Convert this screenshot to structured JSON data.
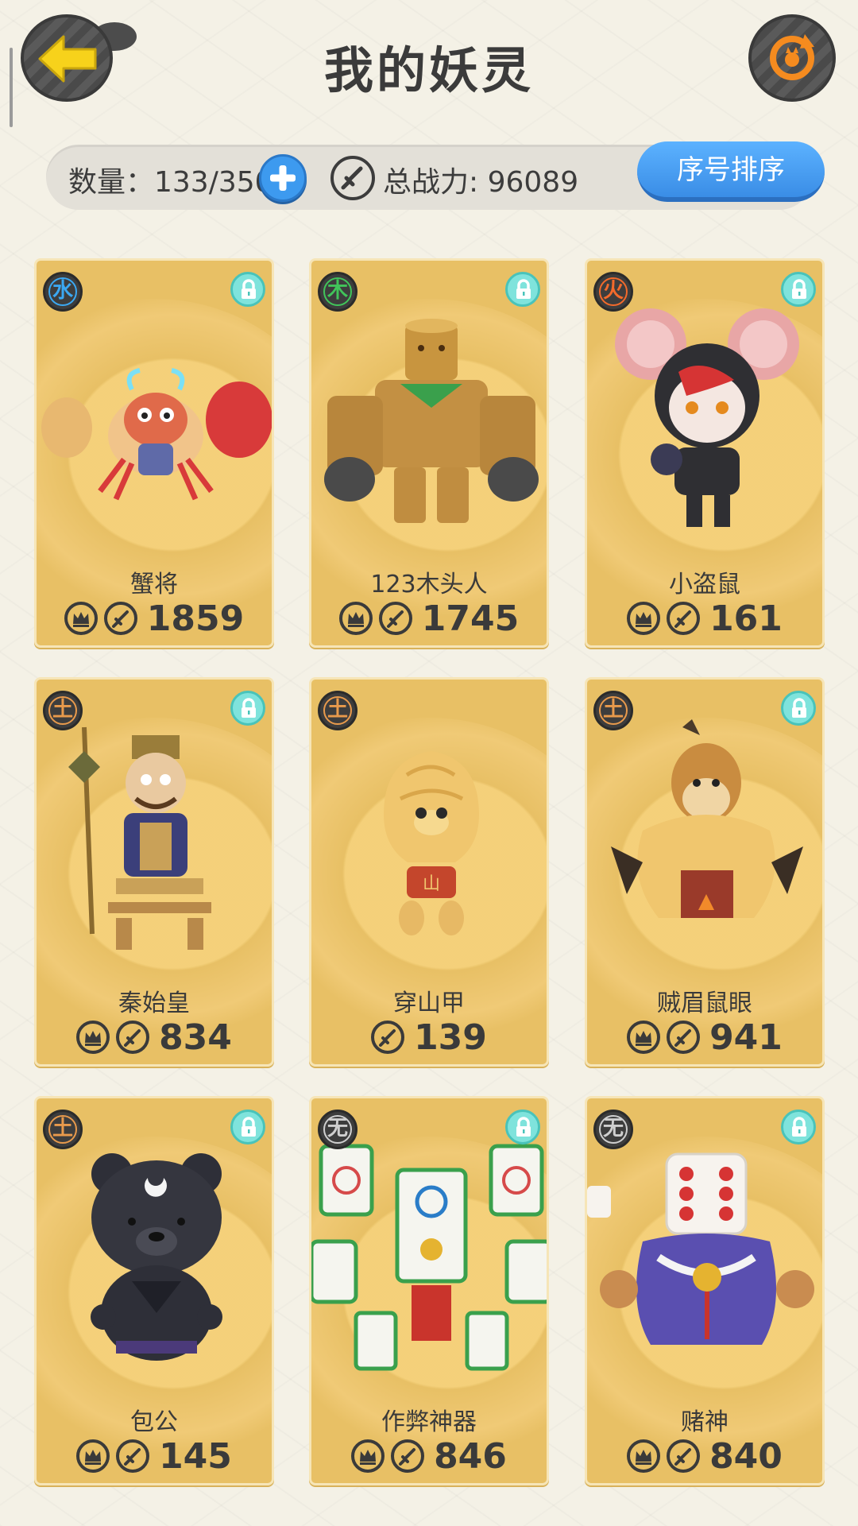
{
  "header": {
    "title": "我的妖灵"
  },
  "stats": {
    "count_text": "数量：133/350",
    "power_text": "总战力: 96089",
    "sort_label": "序号排序"
  },
  "colors": {
    "card": "#e8c065",
    "accent_blue": "#3d9aef",
    "back_arrow": "#f7d21b",
    "refresh_orange": "#f58b1f"
  },
  "cards": [
    {
      "name": "蟹将",
      "element": "水",
      "element_color": "#3ba8f2",
      "power": "1859",
      "crowned": true,
      "locked": true,
      "portrait": "crab"
    },
    {
      "name": "123木头人",
      "element": "木",
      "element_color": "#41c45a",
      "power": "1745",
      "crowned": true,
      "locked": true,
      "portrait": "wood"
    },
    {
      "name": "小盗鼠",
      "element": "火",
      "element_color": "#f36a2b",
      "power": "161",
      "crowned": true,
      "locked": true,
      "portrait": "mouse"
    },
    {
      "name": "秦始皇",
      "element": "土",
      "element_color": "#e89a4c",
      "power": "834",
      "crowned": true,
      "locked": true,
      "portrait": "emperor"
    },
    {
      "name": "穿山甲",
      "element": "土",
      "element_color": "#e89a4c",
      "power": "139",
      "crowned": false,
      "locked": false,
      "portrait": "pangolin"
    },
    {
      "name": "贼眉鼠眼",
      "element": "土",
      "element_color": "#e89a4c",
      "power": "941",
      "crowned": true,
      "locked": true,
      "portrait": "weasel"
    },
    {
      "name": "包公",
      "element": "土",
      "element_color": "#e89a4c",
      "power": "145",
      "crowned": true,
      "locked": true,
      "portrait": "bear"
    },
    {
      "name": "作弊神器",
      "element": "无",
      "element_color": "#cfcfcf",
      "power": "846",
      "crowned": true,
      "locked": true,
      "portrait": "mahjong"
    },
    {
      "name": "赌神",
      "element": "无",
      "element_color": "#cfcfcf",
      "power": "840",
      "crowned": true,
      "locked": true,
      "portrait": "dice"
    }
  ]
}
